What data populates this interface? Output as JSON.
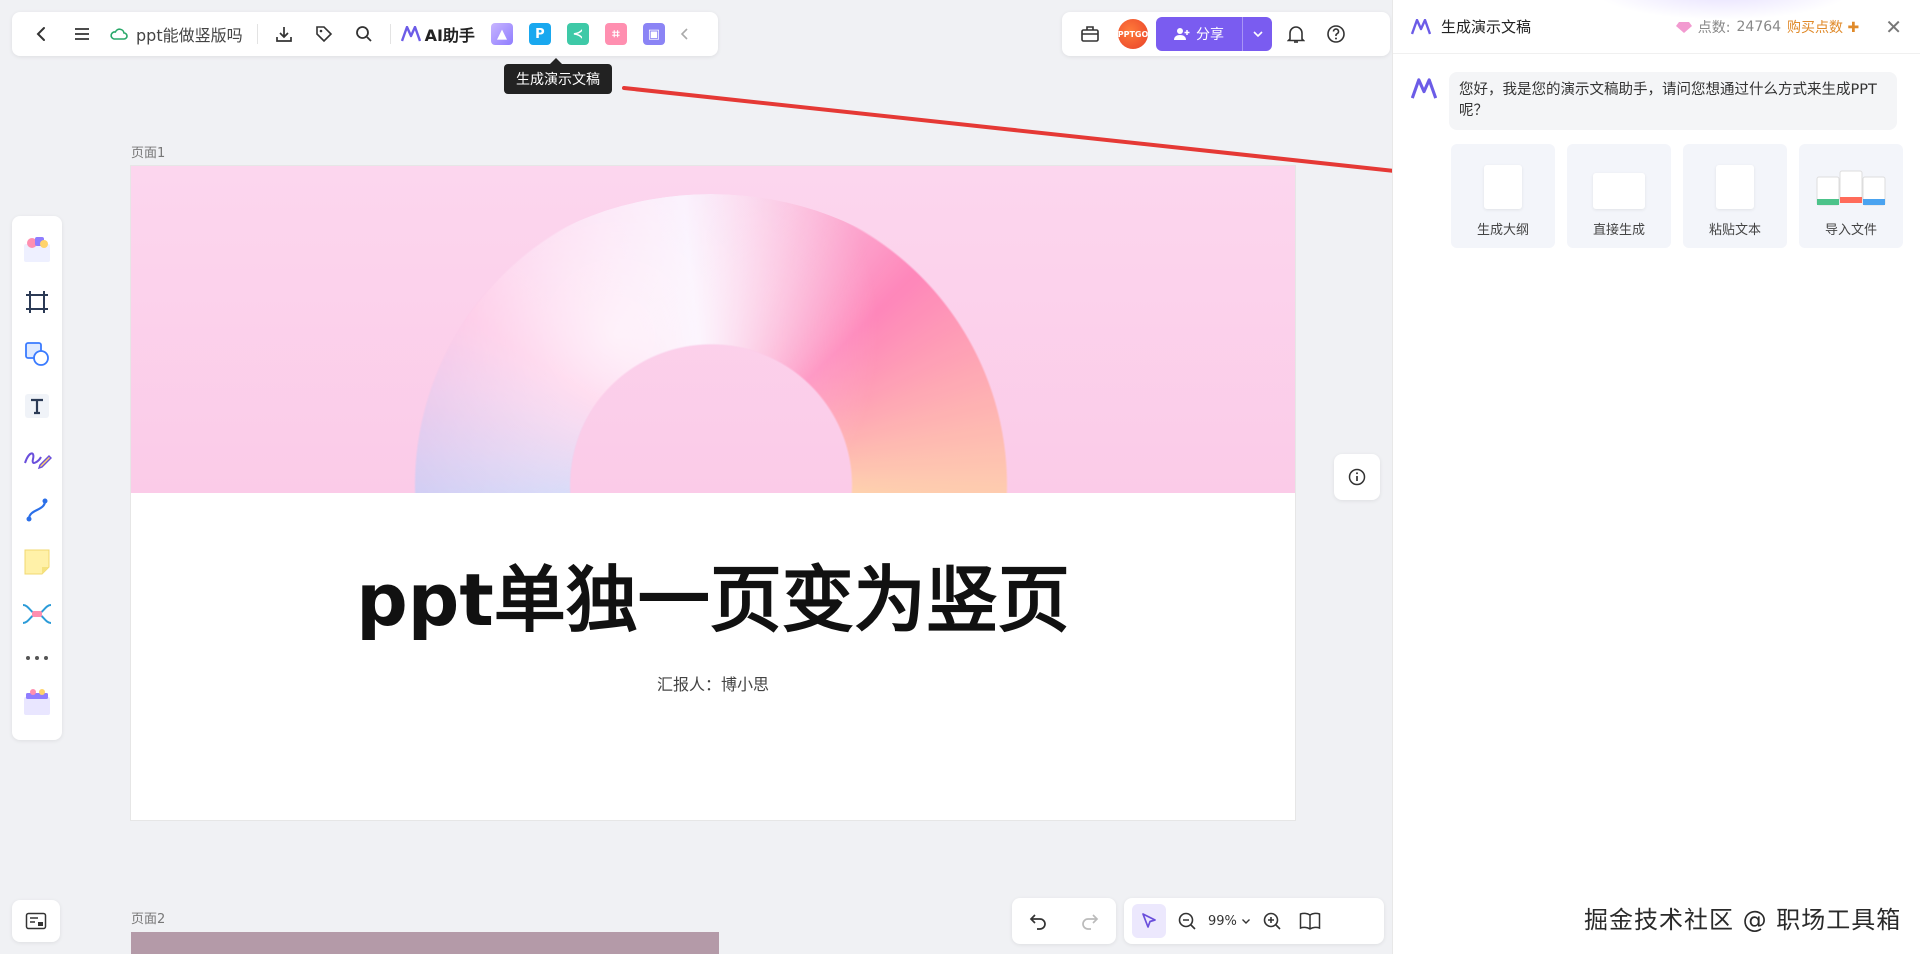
{
  "toolbar": {
    "doc_title": "ppt能做竖版吗",
    "ai_label": "AI助手",
    "tooltip": "生成演示文稿"
  },
  "topbar_right": {
    "avatar_text": "PPTGO",
    "share_label": "分享"
  },
  "canvas": {
    "page1_label": "页面1",
    "page2_label": "页面2",
    "slide_title": "ppt单独一页变为竖页",
    "slide_subtitle": "汇报人：博小思"
  },
  "zoom": {
    "value": "99%"
  },
  "panel": {
    "title": "生成演示文稿",
    "points_label": "点数:",
    "points_value": "24764",
    "buy_label": "购买点数",
    "message": "您好，我是您的演示文稿助手，请问您想通过什么方式来生成PPT呢？",
    "options": [
      {
        "label": "生成大纲"
      },
      {
        "label": "直接生成"
      },
      {
        "label": "粘贴文本"
      },
      {
        "label": "导入文件"
      }
    ]
  },
  "watermark": "掘金技术社区 @ 职场工具箱",
  "colors": {
    "accent": "#7a5cf0",
    "arrow": "#e53935",
    "hero_bg": "#fcd6ee"
  }
}
